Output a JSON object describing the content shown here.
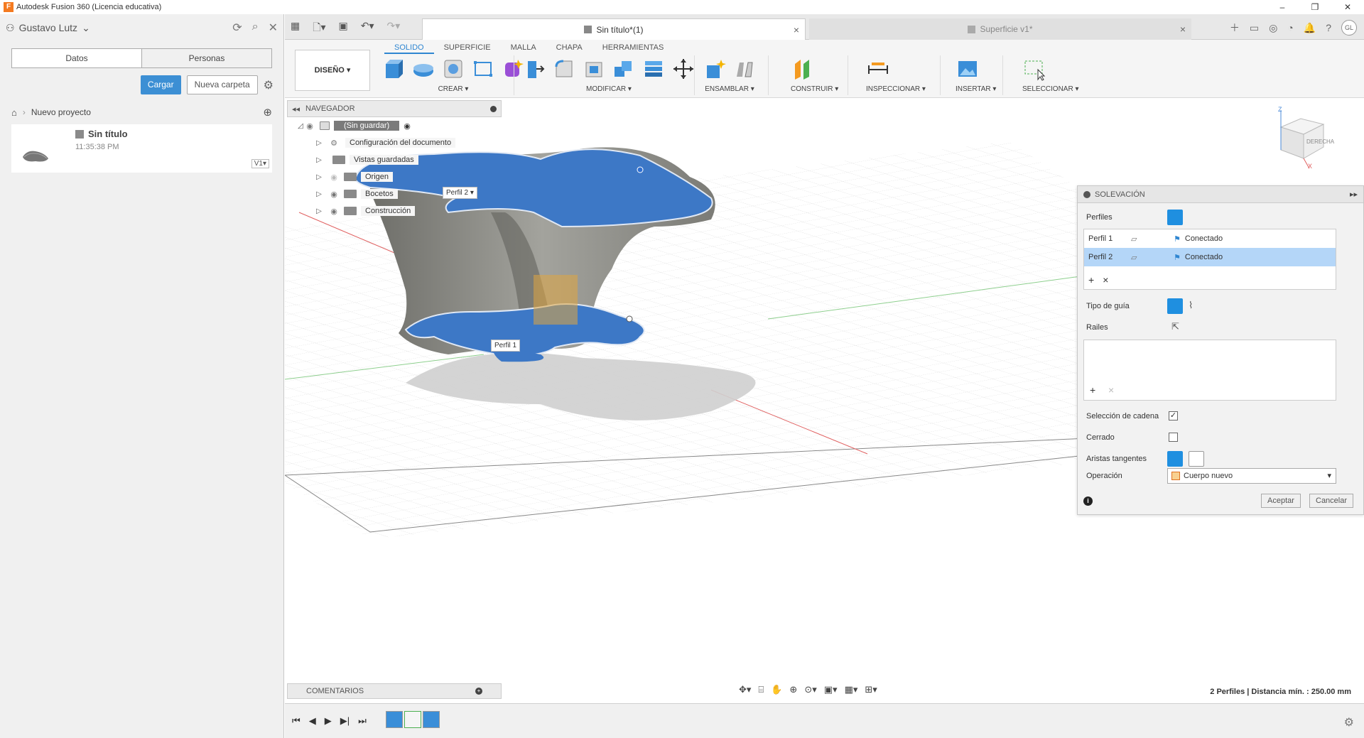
{
  "titlebar": {
    "title": "Autodesk Fusion 360 (Licencia educativa)",
    "app_letter": "F"
  },
  "datapanel": {
    "user": "Gustavo Lutz",
    "tabs": [
      "Datos",
      "Personas"
    ],
    "upload_label": "Cargar",
    "new_folder_label": "Nueva carpeta",
    "breadcrumb": "Nuevo proyecto",
    "file": {
      "name": "Sin título",
      "time": "11:35:38 PM",
      "version": "V1"
    }
  },
  "tabs": {
    "active": "Sin título*(1)",
    "inactive": "Superficie v1*",
    "avatar": "GL"
  },
  "ribbon": {
    "workspace": "DISEÑO",
    "tabs": [
      "SOLIDO",
      "SUPERFICIE",
      "MALLA",
      "CHAPA",
      "HERRAMIENTAS"
    ],
    "groups": [
      "CREAR",
      "MODIFICAR",
      "ENSAMBLAR",
      "CONSTRUIR",
      "INSPECCIONAR",
      "INSERTAR",
      "SELECCIONAR"
    ]
  },
  "navigator": {
    "title": "NAVEGADOR",
    "root": "(Sin guardar)",
    "items": [
      "Configuración del documento",
      "Vistas guardadas",
      "Origen",
      "Bocetos",
      "Construcción"
    ]
  },
  "viewcube": {
    "face": "DERECHA",
    "top_label": "Z",
    "axis_x": "X"
  },
  "viewport": {
    "profile1_label": "Perfil 1",
    "profile2_label": "Perfil 2"
  },
  "loft": {
    "title": "SOLEVACIÓN",
    "profiles_label": "Perfiles",
    "profiles": [
      {
        "name": "Perfil 1",
        "status": "Conectado"
      },
      {
        "name": "Perfil 2",
        "status": "Conectado"
      }
    ],
    "guide_type_label": "Tipo de guía",
    "rails_label": "Railes",
    "chain_label": "Selección de cadena",
    "closed_label": "Cerrado",
    "tangent_label": "Aristas tangentes",
    "operation_label": "Operación",
    "operation_value": "Cuerpo nuevo",
    "ok_label": "Aceptar",
    "cancel_label": "Cancelar",
    "info": "i"
  },
  "comments": {
    "title": "COMENTARIOS"
  },
  "status": {
    "text": "2 Perfiles | Distancia mín. : 250.00 mm"
  },
  "colors": {
    "accent": "#2f86d1",
    "profile_fill": "#3d78c6",
    "body": "#8f8f8a"
  }
}
